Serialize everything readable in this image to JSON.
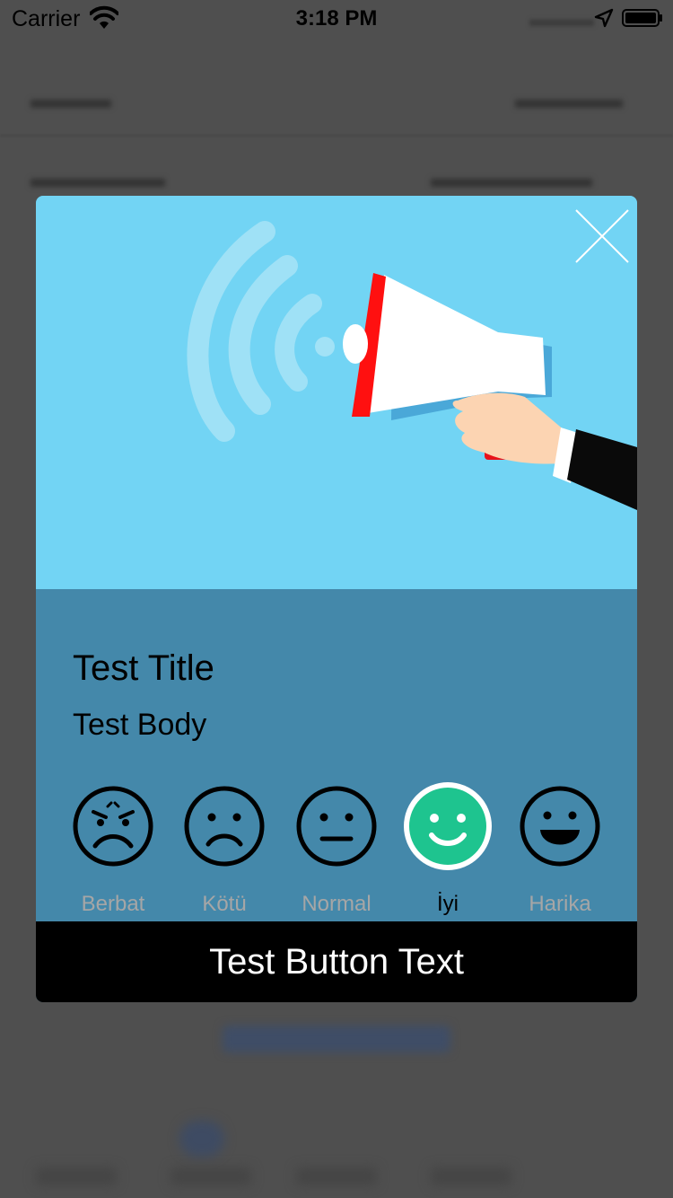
{
  "status_bar": {
    "carrier": "Carrier",
    "time": "3:18 PM"
  },
  "modal": {
    "title": "Test Title",
    "body": "Test Body",
    "button_label": "Test Button Text",
    "hero_color": "#72d4f4",
    "content_color": "#4488aa",
    "ratings": [
      {
        "label": "Berbat",
        "icon": "angry-face-icon",
        "selected": false
      },
      {
        "label": "Kötü",
        "icon": "sad-face-icon",
        "selected": false
      },
      {
        "label": "Normal",
        "icon": "neutral-face-icon",
        "selected": false
      },
      {
        "label": "İyi",
        "icon": "smile-face-icon",
        "selected": true
      },
      {
        "label": "Harika",
        "icon": "grin-face-icon",
        "selected": false
      }
    ],
    "selected_color": "#1ec48f"
  }
}
